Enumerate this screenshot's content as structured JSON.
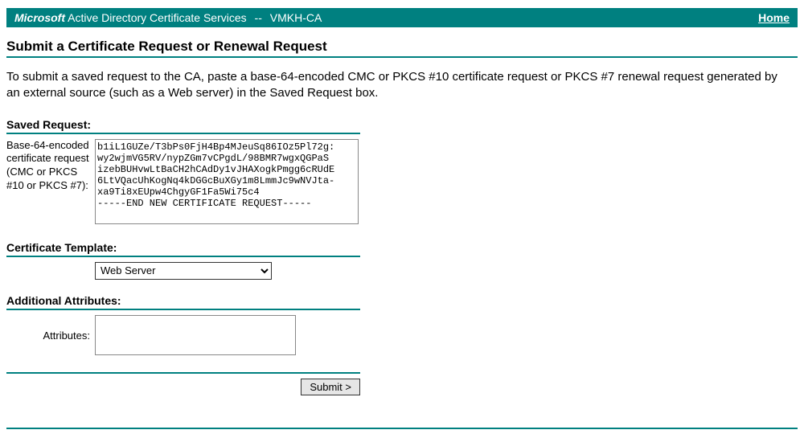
{
  "header": {
    "brand": "Microsoft",
    "product": "Active Directory Certificate Services",
    "separator": "--",
    "ca_name": "VMKH-CA",
    "home_link": "Home"
  },
  "page": {
    "title": "Submit a Certificate Request or Renewal Request",
    "instructions": "To submit a saved request to the CA, paste a base-64-encoded CMC or PKCS #10 certificate request or PKCS #7 renewal request generated by an external source (such as a Web server) in the Saved Request box."
  },
  "saved_request": {
    "heading": "Saved Request:",
    "label": "Base-64-encoded certificate request (CMC or PKCS #10 or PKCS #7):",
    "value": "b1iL1GUZe/T3bPs0FjH4Bp4MJeuSq86IOz5Pl72g:\nwy2wjmVG5RV/nypZGm7vCPgdL/98BMR7wgxQGPaS\nizebBUHvwLtBaCH2hCAdDy1vJHAXogkPmgg6cRUdE\n6LtVQacUhKogNq4kDGGcBuXGy1m8LmmJc9wNVJta-\nxa9Ti8xEUpw4ChgyGF1Fa5Wi75c4\n-----END NEW CERTIFICATE REQUEST-----"
  },
  "certificate_template": {
    "heading": "Certificate Template:",
    "selected": "Web Server"
  },
  "additional_attributes": {
    "heading": "Additional Attributes:",
    "label": "Attributes:",
    "value": ""
  },
  "submit": {
    "label": "Submit >"
  }
}
